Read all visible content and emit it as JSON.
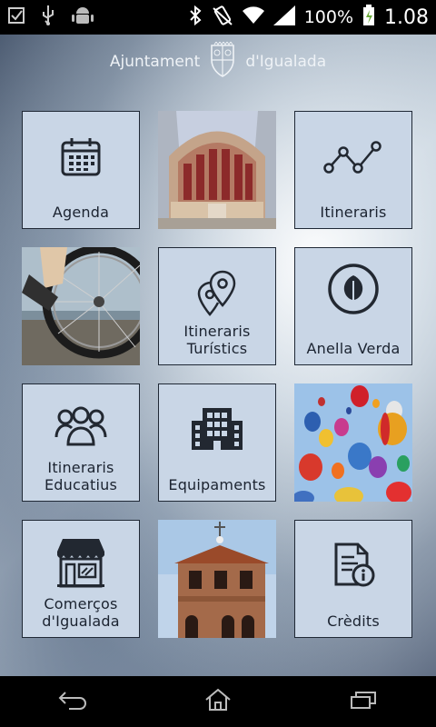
{
  "status_bar": {
    "battery_percent": "100%",
    "time": "1.08",
    "icons": [
      "checkbox-icon",
      "usb-icon",
      "android-icon",
      "bluetooth-icon",
      "vibrate-icon",
      "wifi-icon",
      "signal-icon",
      "battery-icon"
    ]
  },
  "header": {
    "left_text": "Ajuntament",
    "right_text": "d'Igualada",
    "logo": "town-crest-icon"
  },
  "tiles": {
    "agenda": {
      "label": "Agenda",
      "icon": "calendar-icon"
    },
    "church_photo": {
      "image": "church-facade-photo"
    },
    "itineraris": {
      "label": "Itineraris",
      "icon": "route-icon"
    },
    "bike_photo": {
      "image": "bicycle-wheel-photo"
    },
    "itineraris_turistics": {
      "label1": "Itineraris",
      "label2": "Turístics",
      "icon": "map-pins-icon"
    },
    "anella_verda": {
      "label": "Anella Verda",
      "icon": "leaf-icon"
    },
    "itineraris_educatius": {
      "label1": "Itineraris",
      "label2": "Educatius",
      "icon": "people-group-icon"
    },
    "equipaments": {
      "label": "Equipaments",
      "icon": "building-icon"
    },
    "balloons_photo": {
      "image": "hot-air-balloons-photo"
    },
    "comercos": {
      "label1": "Comerços",
      "label2": "d'Igualada",
      "icon": "shop-icon"
    },
    "tower_photo": {
      "image": "bell-tower-photo"
    },
    "credits": {
      "label": "Crèdits",
      "icon": "document-info-icon"
    }
  },
  "nav_bar": {
    "buttons": [
      "back-icon",
      "home-icon",
      "recent-apps-icon"
    ]
  },
  "colors": {
    "tile_bg": "#c9d6e6",
    "tile_border": "#1f2835",
    "icon": "#222831"
  }
}
